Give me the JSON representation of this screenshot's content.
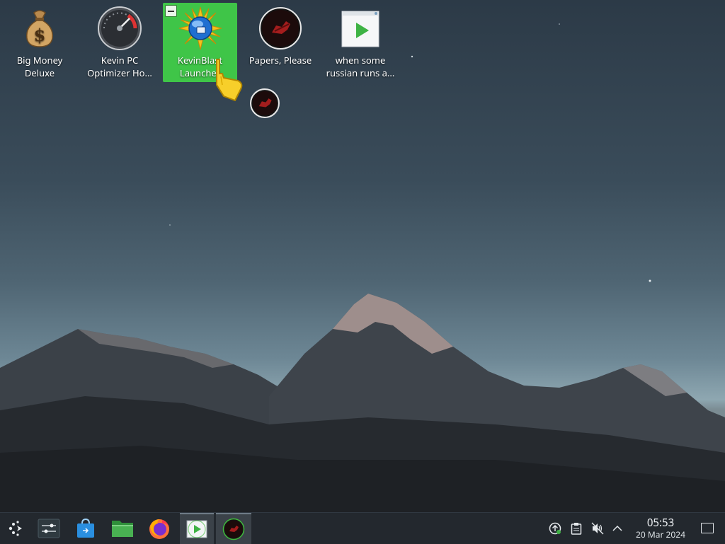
{
  "desktop": {
    "icons": [
      {
        "label": "Big Money Deluxe",
        "icon": "money-bag-icon"
      },
      {
        "label": "Kevin PC Optimizer Ho...",
        "icon": "speedometer-icon"
      },
      {
        "label": "KevinBlast Launcher",
        "icon": "sun-globe-icon",
        "selected": true
      },
      {
        "label": "Papers, Please",
        "icon": "papers-please-icon"
      },
      {
        "label": "when some russian runs a...",
        "icon": "video-file-icon"
      }
    ],
    "drag_ghost_icon": "papers-please-icon"
  },
  "taskbar": {
    "launcher_icon": "app-launcher-icon",
    "items": [
      {
        "name": "system-settings",
        "icon": "settings-sliders-icon"
      },
      {
        "name": "discover",
        "icon": "store-bag-icon"
      },
      {
        "name": "file-manager",
        "icon": "folder-icon"
      },
      {
        "name": "firefox",
        "icon": "firefox-icon"
      },
      {
        "name": "video-player",
        "icon": "video-player-icon",
        "active": true
      },
      {
        "name": "papers-please",
        "icon": "papers-please-icon",
        "active": true
      }
    ],
    "tray": [
      "update-icon",
      "clipboard-icon",
      "volume-muted-icon",
      "chevron-up-icon"
    ],
    "clock": {
      "time": "05:53",
      "date": "20 Mar 2024"
    }
  },
  "colors": {
    "selection": "#3fc548",
    "taskbar": "#23282e",
    "accent": "#40b93c"
  }
}
